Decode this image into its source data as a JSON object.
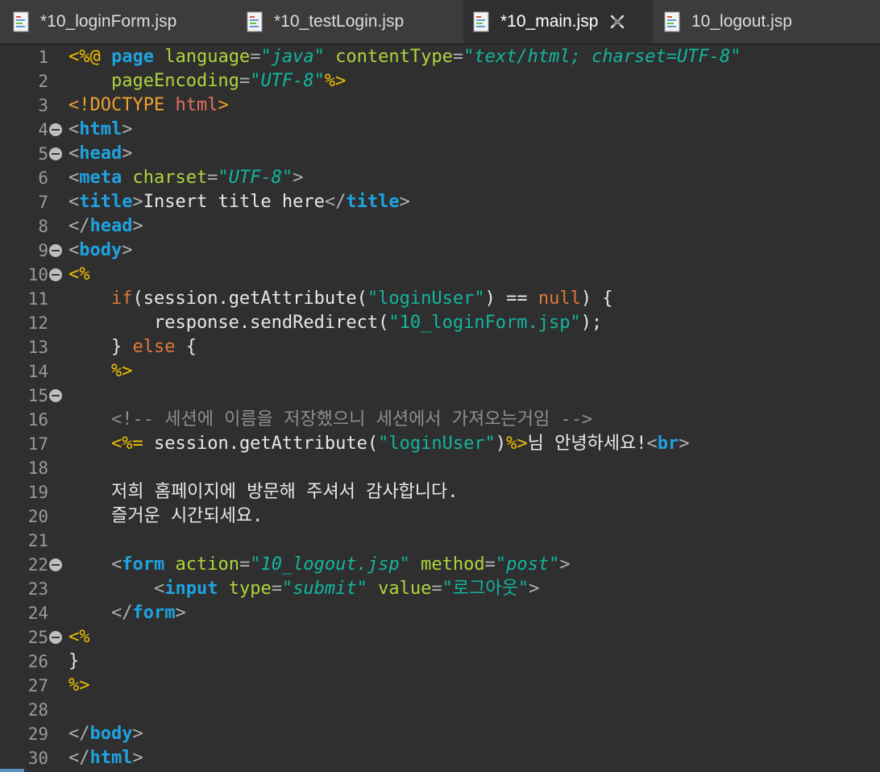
{
  "tabs": [
    {
      "label": "*10_loginForm.jsp",
      "active": false
    },
    {
      "label": "*10_testLogin.jsp",
      "active": false
    },
    {
      "label": "*10_main.jsp",
      "active": true
    },
    {
      "label": "10_logout.jsp",
      "active": false
    }
  ],
  "icons": {
    "file": "jsp-file-icon",
    "close": "close-icon",
    "fold": "fold-collapse-icon"
  },
  "colors": {
    "background": "#2f2f2f",
    "delimiter": "#f0c000",
    "tag": "#1fa3e0",
    "attribute": "#b0d43c",
    "string": "#13b5a0",
    "keyword": "#e0773a",
    "comment": "#8e8e8e",
    "text": "#e8e8e8"
  },
  "lines": [
    {
      "n": "1",
      "fold": false,
      "tokens": [
        {
          "t": "<%@ ",
          "c": "delim"
        },
        {
          "t": "page ",
          "c": "kw"
        },
        {
          "t": "language",
          "c": "attr"
        },
        {
          "t": "=",
          "c": "punct"
        },
        {
          "t": "\"",
          "c": "str"
        },
        {
          "t": "java",
          "c": "stri"
        },
        {
          "t": "\" ",
          "c": "str"
        },
        {
          "t": "contentType",
          "c": "attr"
        },
        {
          "t": "=",
          "c": "punct"
        },
        {
          "t": "\"",
          "c": "str"
        },
        {
          "t": "text/html; charset=UTF-8",
          "c": "stri"
        },
        {
          "t": "\"",
          "c": "str"
        }
      ]
    },
    {
      "n": "2",
      "fold": false,
      "tokens": [
        {
          "t": "    ",
          "c": "txt"
        },
        {
          "t": "pageEncoding",
          "c": "attr"
        },
        {
          "t": "=",
          "c": "punct"
        },
        {
          "t": "\"",
          "c": "str"
        },
        {
          "t": "UTF-8",
          "c": "stri"
        },
        {
          "t": "\"",
          "c": "str"
        },
        {
          "t": "%>",
          "c": "delim"
        }
      ]
    },
    {
      "n": "3",
      "fold": false,
      "tokens": [
        {
          "t": "<!DOCTYPE ",
          "c": "dt"
        },
        {
          "t": "html",
          "c": "dtname"
        },
        {
          "t": ">",
          "c": "dt"
        }
      ]
    },
    {
      "n": "4",
      "fold": true,
      "tokens": [
        {
          "t": "<",
          "c": "punct"
        },
        {
          "t": "html",
          "c": "kw"
        },
        {
          "t": ">",
          "c": "punct"
        }
      ]
    },
    {
      "n": "5",
      "fold": true,
      "tokens": [
        {
          "t": "<",
          "c": "punct"
        },
        {
          "t": "head",
          "c": "kw"
        },
        {
          "t": ">",
          "c": "punct"
        }
      ]
    },
    {
      "n": "6",
      "fold": false,
      "tokens": [
        {
          "t": "<",
          "c": "punct"
        },
        {
          "t": "meta ",
          "c": "kw"
        },
        {
          "t": "charset",
          "c": "attr"
        },
        {
          "t": "=",
          "c": "punct"
        },
        {
          "t": "\"",
          "c": "str"
        },
        {
          "t": "UTF-8",
          "c": "stri"
        },
        {
          "t": "\"",
          "c": "str"
        },
        {
          "t": ">",
          "c": "punct"
        }
      ]
    },
    {
      "n": "7",
      "fold": false,
      "tokens": [
        {
          "t": "<",
          "c": "punct"
        },
        {
          "t": "title",
          "c": "kw"
        },
        {
          "t": ">",
          "c": "punct"
        },
        {
          "t": "Insert title here",
          "c": "txt"
        },
        {
          "t": "</",
          "c": "punct"
        },
        {
          "t": "title",
          "c": "kw"
        },
        {
          "t": ">",
          "c": "punct"
        }
      ]
    },
    {
      "n": "8",
      "fold": false,
      "tokens": [
        {
          "t": "</",
          "c": "punct"
        },
        {
          "t": "head",
          "c": "kw"
        },
        {
          "t": ">",
          "c": "punct"
        }
      ]
    },
    {
      "n": "9",
      "fold": true,
      "tokens": [
        {
          "t": "<",
          "c": "punct"
        },
        {
          "t": "body",
          "c": "kw"
        },
        {
          "t": ">",
          "c": "punct"
        }
      ]
    },
    {
      "n": "10",
      "fold": true,
      "tokens": [
        {
          "t": "<%",
          "c": "delim"
        }
      ]
    },
    {
      "n": "11",
      "fold": false,
      "tokens": [
        {
          "t": "    ",
          "c": "txt"
        },
        {
          "t": "if",
          "c": "ctrl"
        },
        {
          "t": "(session.getAttribute(",
          "c": "txt"
        },
        {
          "t": "\"loginUser\"",
          "c": "str"
        },
        {
          "t": ") == ",
          "c": "txt"
        },
        {
          "t": "null",
          "c": "ctrl"
        },
        {
          "t": ") {",
          "c": "txt"
        }
      ]
    },
    {
      "n": "12",
      "fold": false,
      "tokens": [
        {
          "t": "        response.sendRedirect(",
          "c": "txt"
        },
        {
          "t": "\"10_loginForm.jsp\"",
          "c": "str"
        },
        {
          "t": ");",
          "c": "txt"
        }
      ]
    },
    {
      "n": "13",
      "fold": false,
      "tokens": [
        {
          "t": "    } ",
          "c": "txt"
        },
        {
          "t": "else",
          "c": "ctrl"
        },
        {
          "t": " {",
          "c": "txt"
        }
      ]
    },
    {
      "n": "14",
      "fold": false,
      "tokens": [
        {
          "t": "    ",
          "c": "txt"
        },
        {
          "t": "%>",
          "c": "delim"
        }
      ]
    },
    {
      "n": "15",
      "fold": true,
      "tokens": []
    },
    {
      "n": "16",
      "fold": false,
      "tokens": [
        {
          "t": "    ",
          "c": "txt"
        },
        {
          "t": "<!-- 세션에 이름을 저장했으니 세션에서 가져오는거임 -->",
          "c": "cmt"
        }
      ]
    },
    {
      "n": "17",
      "fold": false,
      "tokens": [
        {
          "t": "    ",
          "c": "txt"
        },
        {
          "t": "<%=",
          "c": "delim"
        },
        {
          "t": " session.getAttribute(",
          "c": "txt"
        },
        {
          "t": "\"loginUser\"",
          "c": "str"
        },
        {
          "t": ")",
          "c": "txt"
        },
        {
          "t": "%>",
          "c": "delim"
        },
        {
          "t": "님 안녕하세요!",
          "c": "txt"
        },
        {
          "t": "<",
          "c": "punct"
        },
        {
          "t": "br",
          "c": "kw"
        },
        {
          "t": ">",
          "c": "punct"
        }
      ]
    },
    {
      "n": "18",
      "fold": false,
      "tokens": []
    },
    {
      "n": "19",
      "fold": false,
      "tokens": [
        {
          "t": "    저희 홈페이지에 방문해 주셔서 감사합니다.",
          "c": "txt"
        }
      ]
    },
    {
      "n": "20",
      "fold": false,
      "tokens": [
        {
          "t": "    즐거운 시간되세요.",
          "c": "txt"
        }
      ]
    },
    {
      "n": "21",
      "fold": false,
      "tokens": []
    },
    {
      "n": "22",
      "fold": true,
      "tokens": [
        {
          "t": "    ",
          "c": "txt"
        },
        {
          "t": "<",
          "c": "punct"
        },
        {
          "t": "form ",
          "c": "kw"
        },
        {
          "t": "action",
          "c": "attr"
        },
        {
          "t": "=",
          "c": "punct"
        },
        {
          "t": "\"",
          "c": "str"
        },
        {
          "t": "10_logout.jsp",
          "c": "stri"
        },
        {
          "t": "\" ",
          "c": "str"
        },
        {
          "t": "method",
          "c": "attr"
        },
        {
          "t": "=",
          "c": "punct"
        },
        {
          "t": "\"",
          "c": "str"
        },
        {
          "t": "post",
          "c": "stri"
        },
        {
          "t": "\"",
          "c": "str"
        },
        {
          "t": ">",
          "c": "punct"
        }
      ]
    },
    {
      "n": "23",
      "fold": false,
      "tokens": [
        {
          "t": "        ",
          "c": "txt"
        },
        {
          "t": "<",
          "c": "punct"
        },
        {
          "t": "input ",
          "c": "kw"
        },
        {
          "t": "type",
          "c": "attr"
        },
        {
          "t": "=",
          "c": "punct"
        },
        {
          "t": "\"",
          "c": "str"
        },
        {
          "t": "submit",
          "c": "stri"
        },
        {
          "t": "\" ",
          "c": "str"
        },
        {
          "t": "value",
          "c": "attr"
        },
        {
          "t": "=",
          "c": "punct"
        },
        {
          "t": "\"로그아웃\"",
          "c": "str"
        },
        {
          "t": ">",
          "c": "punct"
        }
      ]
    },
    {
      "n": "24",
      "fold": false,
      "tokens": [
        {
          "t": "    ",
          "c": "txt"
        },
        {
          "t": "</",
          "c": "punct"
        },
        {
          "t": "form",
          "c": "kw"
        },
        {
          "t": ">",
          "c": "punct"
        }
      ]
    },
    {
      "n": "25",
      "fold": true,
      "tokens": [
        {
          "t": "<%",
          "c": "delim"
        }
      ]
    },
    {
      "n": "26",
      "fold": false,
      "tokens": [
        {
          "t": "}",
          "c": "txt"
        }
      ]
    },
    {
      "n": "27",
      "fold": false,
      "tokens": [
        {
          "t": "%>",
          "c": "delim"
        }
      ]
    },
    {
      "n": "28",
      "fold": false,
      "tokens": []
    },
    {
      "n": "29",
      "fold": false,
      "tokens": [
        {
          "t": "</",
          "c": "punct"
        },
        {
          "t": "body",
          "c": "kw"
        },
        {
          "t": ">",
          "c": "punct"
        }
      ]
    },
    {
      "n": "30",
      "fold": false,
      "tokens": [
        {
          "t": "</",
          "c": "punct"
        },
        {
          "t": "html",
          "c": "kw"
        },
        {
          "t": ">",
          "c": "punct"
        }
      ]
    }
  ]
}
